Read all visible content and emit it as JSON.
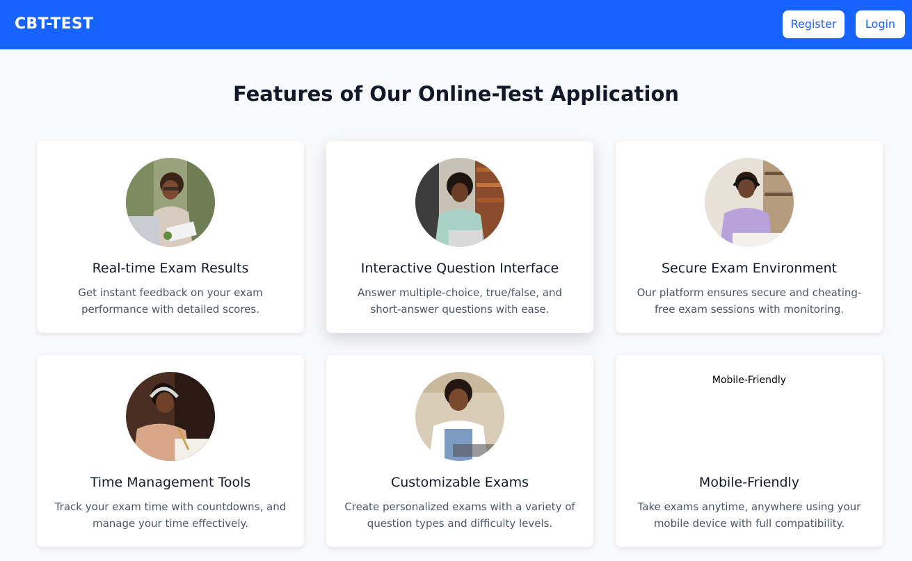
{
  "navbar": {
    "brand": "CBT-TEST",
    "register_label": "Register",
    "login_label": "Login",
    "bg_color": "#1763ff"
  },
  "page": {
    "heading": "Features of Our Online-Test Application"
  },
  "features": [
    {
      "title": "Real-time Exam Results",
      "description": "Get instant feedback on your exam performance with detailed scores."
    },
    {
      "title": "Interactive Question Interface",
      "description": "Answer multiple-choice, true/false, and short-answer questions with ease."
    },
    {
      "title": "Secure Exam Environment",
      "description": "Our platform ensures secure and cheating-free exam sessions with monitoring."
    },
    {
      "title": "Time Management Tools",
      "description": "Track your exam time with countdowns, and manage your time effectively."
    },
    {
      "title": "Customizable Exams",
      "description": "Create personalized exams with a variety of question types and difficulty levels."
    },
    {
      "title": "Mobile-Friendly",
      "description": "Take exams anytime, anywhere using your mobile device with full compatibility.",
      "image_alt": "Mobile-Friendly"
    }
  ]
}
